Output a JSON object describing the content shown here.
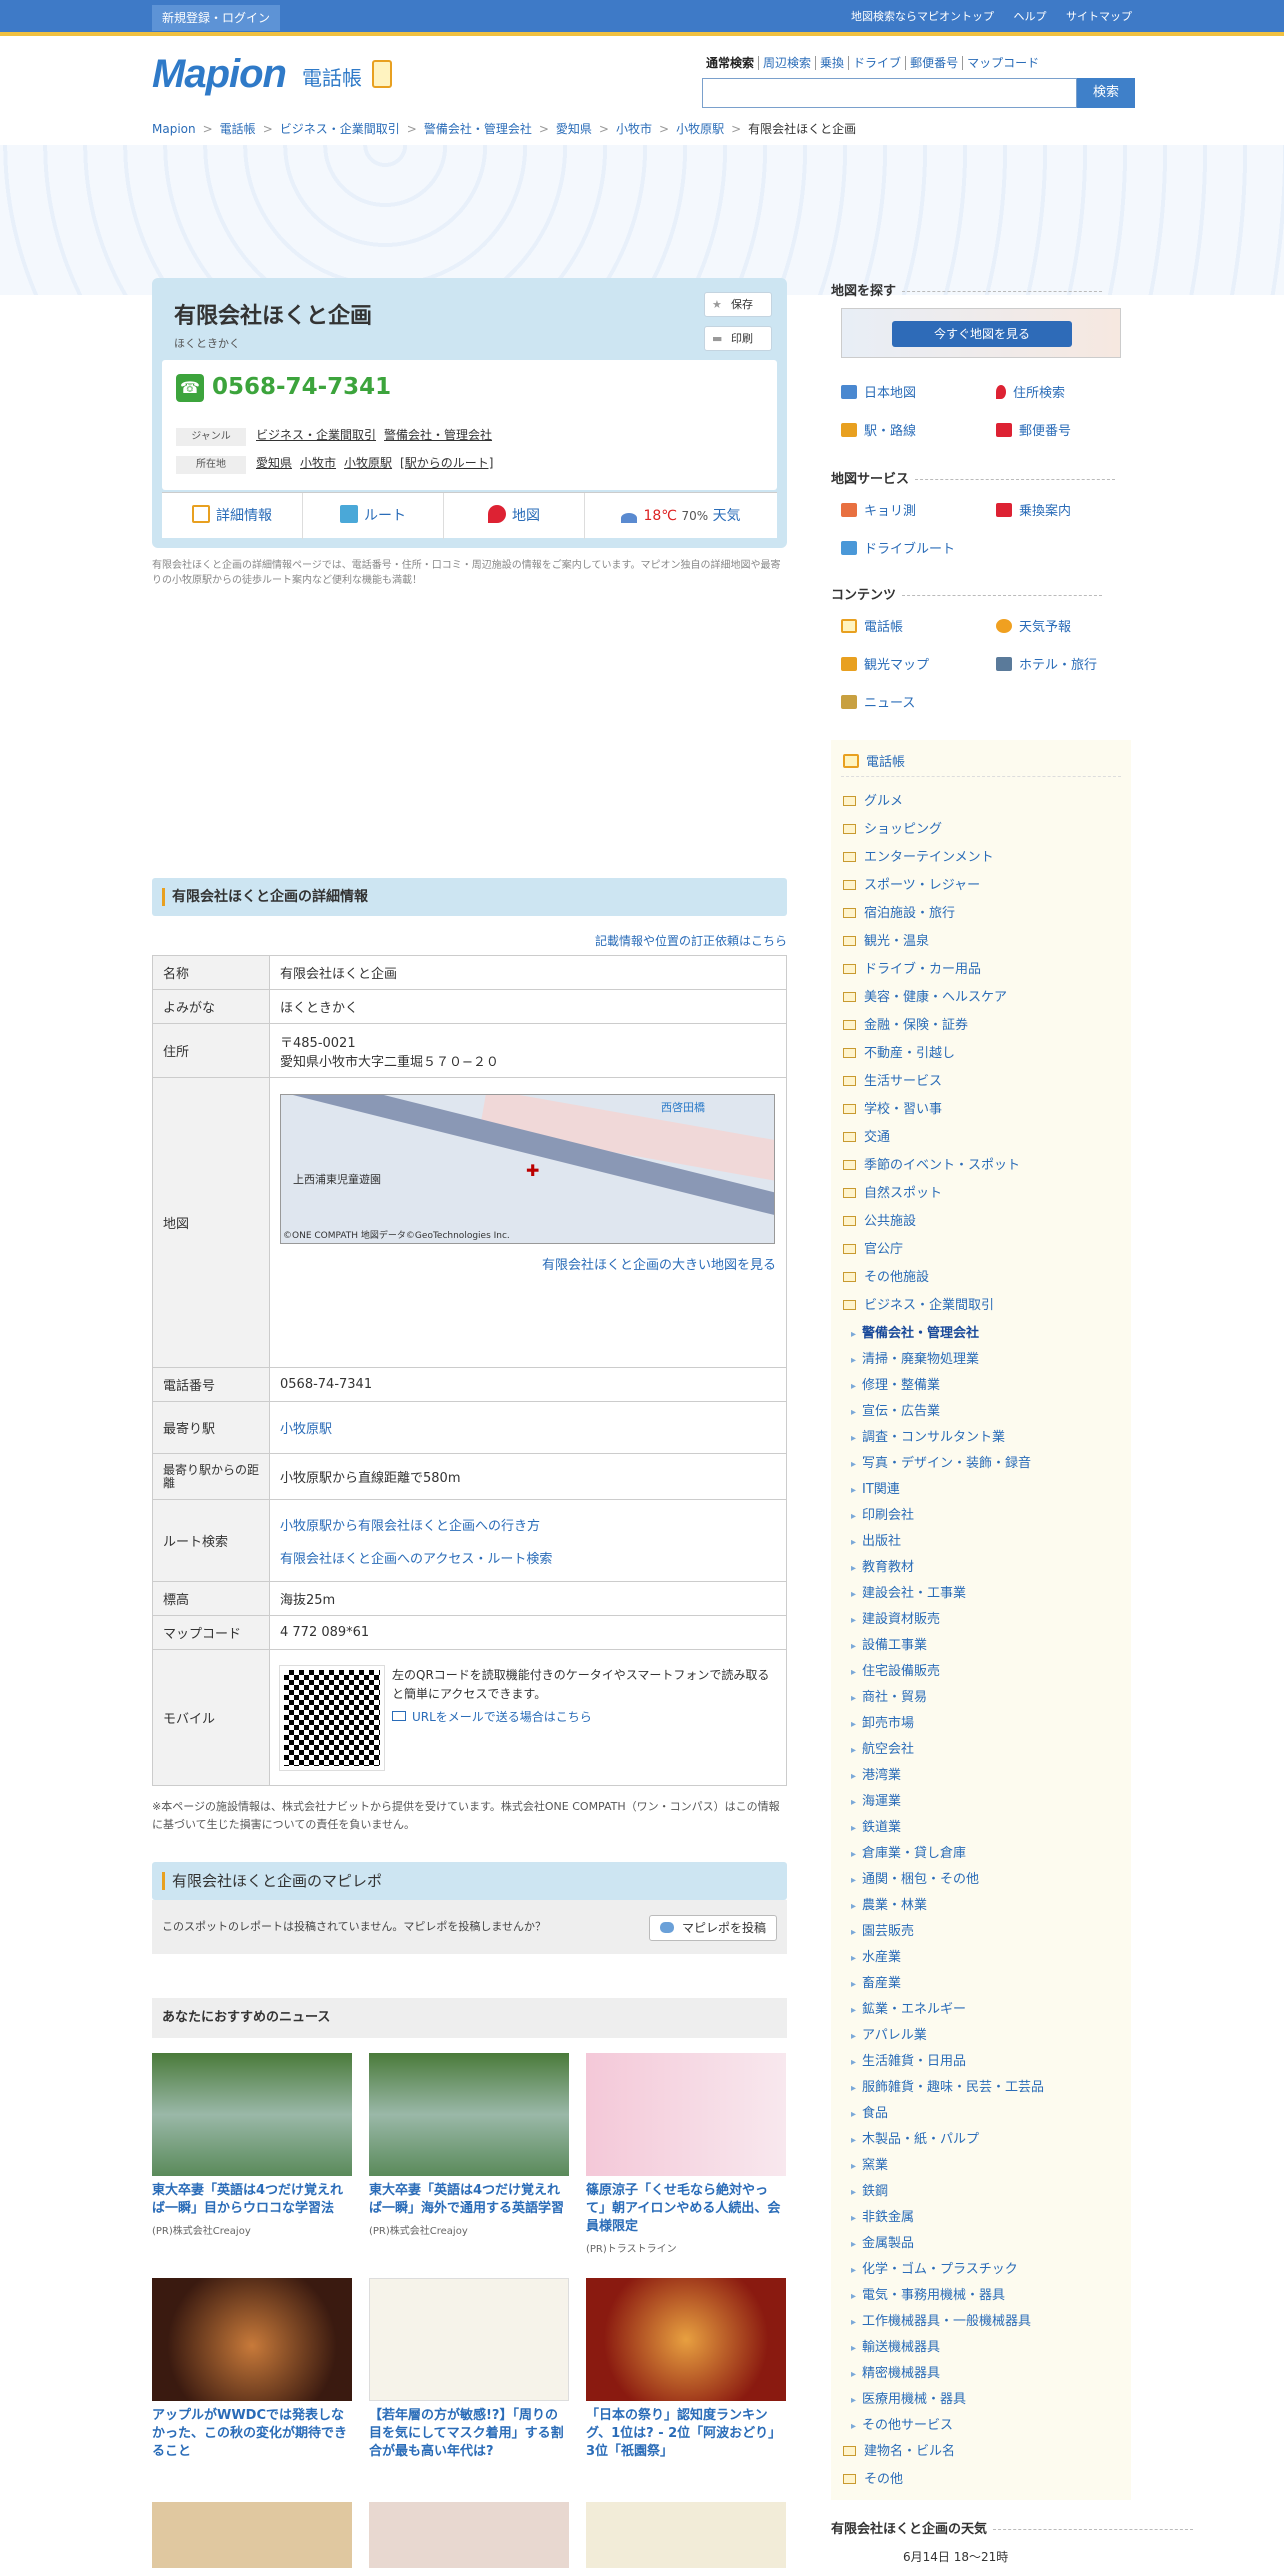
{
  "topbar": {
    "register": "新規登録・ログイン",
    "links": [
      "地図検索ならマピオントップ",
      "ヘルプ",
      "サイトマップ"
    ]
  },
  "header": {
    "logo": "Mapion",
    "logo_sub": "電話帳",
    "search_tabs": [
      "通常検索",
      "周辺検索",
      "乗換",
      "ドライブ",
      "郵便番号",
      "マップコード"
    ],
    "search_button": "検索",
    "search_value": ""
  },
  "breadcrumb": [
    "Mapion",
    "電話帳",
    "ビジネス・企業間取引",
    "警備会社・管理会社",
    "愛知県",
    "小牧市",
    "小牧原駅",
    "有限会社ほくと企画"
  ],
  "card": {
    "name": "有限会社ほくと企画",
    "kana": "ほくときかく",
    "save": "保存",
    "print": "印刷",
    "phone": "0568-74-7341",
    "genre_label": "ジャンル",
    "genres": [
      "ビジネス・企業間取引",
      "警備会社・管理会社"
    ],
    "address_label": "所在地",
    "addresses": [
      "愛知県",
      "小牧市",
      "小牧原駅",
      "[駅からのルート]"
    ],
    "actions": {
      "detail": "詳細情報",
      "route": "ルート",
      "map": "地図",
      "weather_temp": "18℃",
      "weather_rain": "70%",
      "weather": "天気"
    }
  },
  "card_note": "有限会社ほくと企画の詳細情報ページでは、電話番号・住所・口コミ・周辺施設の情報をご案内しています。マピオン独自の詳細地図や最寄りの小牧原駅からの徒歩ルート案内など便利な機能も満載！",
  "detail": {
    "heading": "有限会社ほくと企画の詳細情報",
    "correction": "記載情報や位置の訂正依頼はこちら",
    "rows": {
      "name_k": "名称",
      "name_v": "有限会社ほくと企画",
      "kana_k": "よみがな",
      "kana_v": "ほくときかく",
      "addr_k": "住所",
      "zip": "〒485-0021",
      "addr_v": "愛知県小牧市大字二重堀５７０−２０",
      "map_k": "地図",
      "map_link": "有限会社ほくと企画の大きい地図を見る",
      "map_copy": "©ONE COMPATH 地図データ©GeoTechnologies Inc.",
      "map_label1": "西啓田橋",
      "map_label2": "上西浦東児童遊園",
      "tel_k": "電話番号",
      "tel_v": "0568-74-7341",
      "sta_k": "最寄り駅",
      "sta_v": "小牧原駅",
      "dist_k": "最寄り駅からの距離",
      "dist_v": "小牧原駅から直線距離で580m",
      "route_k": "ルート検索",
      "route_v1": "小牧原駅から有限会社ほくと企画への行き方",
      "route_v2": "有限会社ほくと企画へのアクセス・ルート検索",
      "alt_k": "標高",
      "alt_v": "海抜25m",
      "mc_k": "マップコード",
      "mc_v": "4 772 089*61",
      "mob_k": "モバイル",
      "mob_text": "左のQRコードを読取機能付きのケータイやスマートフォンで読み取ると簡単にアクセスできます。",
      "mob_mail": "URLをメールで送る場合はこちら"
    }
  },
  "disclaimer": "※本ページの施設情報は、株式会社ナビットから提供を受けています。株式会社ONE COMPATH（ワン・コンパス）はこの情報に基づいて生じた損害についての責任を負いません。",
  "mapirepo": {
    "heading": "有限会社ほくと企画のマピレポ",
    "text": "このスポットのレポートは投稿されていません。マピレポを投稿しませんか？",
    "button": "マピレポを投稿"
  },
  "news": {
    "heading": "あなたにおすすめのニュース",
    "items": [
      {
        "title": "東大卒妻「英語は4つだけ覚えれば一瞬」目からウロコな学習法",
        "source": "(PR)株式会社Creajoy"
      },
      {
        "title": "東大卒妻「英語は4つだけ覚えれば一瞬」海外で通用する英語学習",
        "source": "(PR)株式会社Creajoy"
      },
      {
        "title": "篠原涼子「くせ毛なら絶対やって」朝アイロンやめる人続出、会員様限定",
        "source": "(PR)トラストライン"
      },
      {
        "title": "アップルがWWDCでは発表しなかった、この秋の変化が期待できること",
        "source": ""
      },
      {
        "title": "【若年層の方が敏感!?】「周りの目を気にしてマスク着用」する割合が最も高い年代は?",
        "source": ""
      },
      {
        "title": "「日本の祭り」認知度ランキング、1位は? - 2位「阿波おどり」3位「祇園祭」",
        "source": ""
      }
    ]
  },
  "side": {
    "find_map": "地図を探す",
    "see_map": "今すぐ地図を見る",
    "links1": [
      "日本地図",
      "住所検索",
      "駅・路線",
      "郵便番号"
    ],
    "services": "地図サービス",
    "links2": [
      "キョリ測",
      "乗換案内",
      "ドライブルート"
    ],
    "contents": "コンテンツ",
    "links3": [
      "電話帳",
      "天気予報",
      "観光マップ",
      "ホテル・旅行",
      "ニュース"
    ],
    "cat_head": "電話帳",
    "cats": [
      "グルメ",
      "ショッピング",
      "エンターテインメント",
      "スポーツ・レジャー",
      "宿泊施設・旅行",
      "観光・温泉",
      "ドライブ・カー用品",
      "美容・健康・ヘルスケア",
      "金融・保険・証券",
      "不動産・引越し",
      "生活サービス",
      "学校・習い事",
      "交通",
      "季節のイベント・スポット",
      "自然スポット",
      "公共施設",
      "官公庁",
      "その他施設",
      "ビジネス・企業間取引"
    ],
    "subs": [
      "警備会社・管理会社",
      "清掃・廃棄物処理業",
      "修理・整備業",
      "宣伝・広告業",
      "調査・コンサルタント業",
      "写真・デザイン・装飾・録音",
      "IT関連",
      "印刷会社",
      "出版社",
      "教育教材",
      "建設会社・工事業",
      "建設資材販売",
      "設備工事業",
      "住宅設備販売",
      "商社・貿易",
      "卸売市場",
      "航空会社",
      "港湾業",
      "海運業",
      "鉄道業",
      "倉庫業・貸し倉庫",
      "通関・梱包・その他",
      "農業・林業",
      "園芸販売",
      "水産業",
      "畜産業",
      "鉱業・エネルギー",
      "アパレル業",
      "生活雑貨・日用品",
      "服飾雑貨・趣味・民芸・工芸品",
      "食品",
      "木製品・紙・パルプ",
      "窯業",
      "鉄鋼",
      "非鉄金属",
      "金属製品",
      "化学・ゴム・プラスチック",
      "電気・事務用機械・器具",
      "工作機械器具・一般機械器具",
      "輸送機械器具",
      "精密機械器具",
      "医療用機械・器具",
      "その他サービス"
    ],
    "cats_end": [
      "建物名・ビル名",
      "その他"
    ],
    "weather_head": "有限会社ほくと企画の天気",
    "weather_date": "6月14日 18～21時"
  }
}
